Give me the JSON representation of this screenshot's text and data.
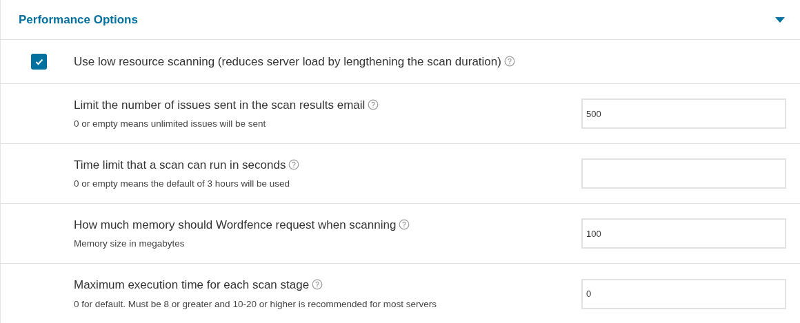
{
  "section": {
    "title": "Performance Options",
    "expanded": true
  },
  "checkbox_option": {
    "label": "Use low resource scanning (reduces server load by lengthening the scan duration)",
    "checked": true
  },
  "fields": [
    {
      "label": "Limit the number of issues sent in the scan results email",
      "hint": "0 or empty means unlimited issues will be sent",
      "value": "500"
    },
    {
      "label": "Time limit that a scan can run in seconds",
      "hint": "0 or empty means the default of 3 hours will be used"
    },
    {
      "label": "How much memory should Wordfence request when scanning",
      "hint": "Memory size in megabytes",
      "value": "100"
    },
    {
      "label": "Maximum execution time for each scan stage",
      "hint": "0 for default. Must be 8 or greater and 10-20 or higher is recommended for most servers",
      "value": "0"
    }
  ]
}
